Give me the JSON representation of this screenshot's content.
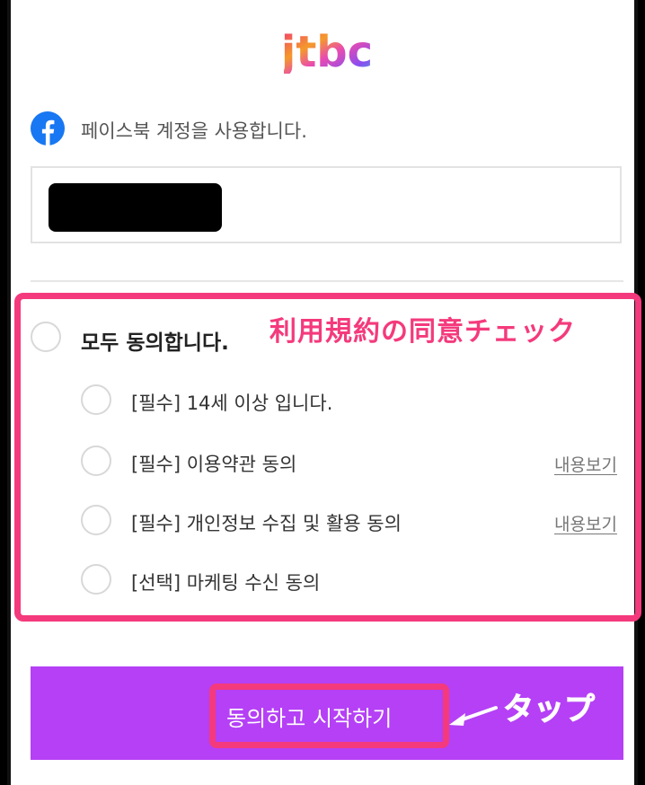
{
  "brand": {
    "logo_text": "jtbc"
  },
  "facebook": {
    "message": "페이스북 계정을 사용합니다."
  },
  "agreements": {
    "all_label": "모두 동의합니다.",
    "items": [
      {
        "label": "[필수] 14세 이상 입니다.",
        "link": ""
      },
      {
        "label": "[필수] 이용약관 동의",
        "link": "내용보기"
      },
      {
        "label": "[필수] 개인정보 수집 및 활용 동의",
        "link": "내용보기"
      },
      {
        "label": "[선택] 마케팅 수신 동의",
        "link": ""
      }
    ]
  },
  "start_button": {
    "label": "동의하고 시작하기",
    "color": "#b540f5"
  },
  "annotations": {
    "terms_note": "利用規約の同意チェック",
    "tap_note": "タップ",
    "color": "#f43a7c"
  }
}
